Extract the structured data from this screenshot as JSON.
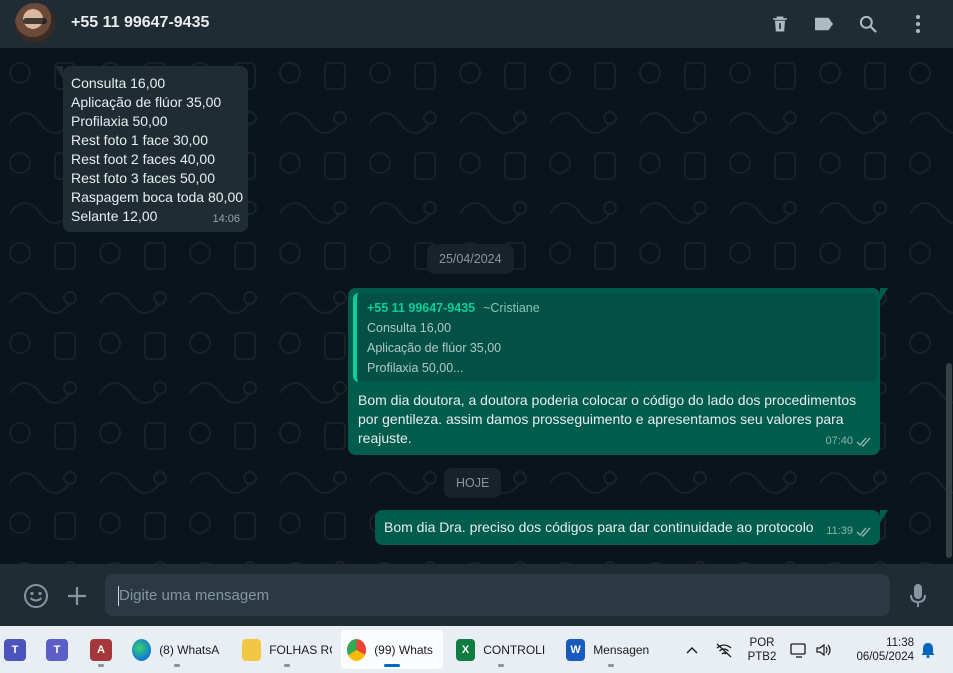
{
  "header": {
    "title": "+55 11 99647-9435",
    "icons": [
      "delete-icon",
      "label-icon",
      "search-icon",
      "menu-icon"
    ]
  },
  "messages": {
    "first": {
      "lines": [
        "Consulta 16,00",
        "Aplicação de flúor 35,00",
        "Profilaxia 50,00",
        "Rest foto 1 face 30,00",
        "Rest foot 2 faces 40,00",
        "Rest foto 3 faces 50,00",
        "Raspagem boca toda 80,00",
        "Selante 12,00"
      ],
      "time": "14:06"
    },
    "date1": "25/04/2024",
    "reply": {
      "quote_author": "+55 11 99647-9435",
      "quote_pushname": "~Cristiane",
      "quote_lines": [
        "Consulta 16,00",
        "Aplicação de flúor 35,00",
        "Profilaxia 50,00..."
      ],
      "lines": [
        "Bom dia doutora, a doutora poderia colocar o código do lado dos procedimentos",
        "por gentileza. assim damos prosseguimento e apresentamos seu valores para",
        "reajuste."
      ],
      "time": "07:40"
    },
    "date2": "HOJE",
    "last": {
      "text": "Bom dia Dra. preciso dos códigos para dar continuidade ao protocolo",
      "time": "11:39"
    }
  },
  "composer": {
    "placeholder": "Digite uma mensagem"
  },
  "taskbar": {
    "apps": [
      {
        "label": "(8) WhatsA"
      },
      {
        "label": "FOLHAS RC"
      },
      {
        "label": "(99) Whats"
      },
      {
        "label": "CONTROLI"
      },
      {
        "label": "Mensagen"
      }
    ],
    "lang": "POR",
    "layout": "PTB2",
    "time": "11:38",
    "date": "06/05/2024"
  },
  "colors": {
    "header_bg": "#202c33",
    "chat_bg": "#0b141a",
    "incoming": "#202c33",
    "outgoing": "#005c4b",
    "accent": "#06cf9c"
  }
}
